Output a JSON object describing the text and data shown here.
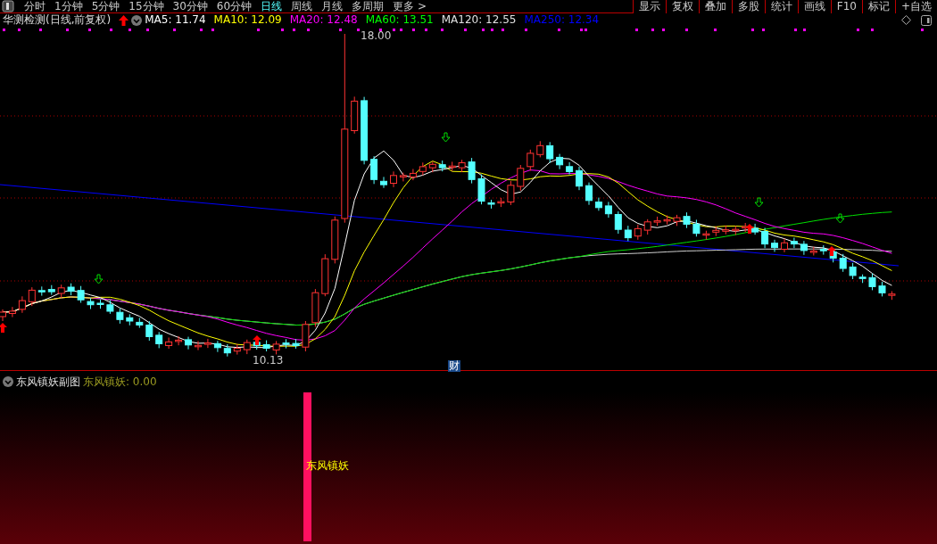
{
  "toolbar": {
    "periods": [
      {
        "label": "分时",
        "selected": false
      },
      {
        "label": "1分钟",
        "selected": false
      },
      {
        "label": "5分钟",
        "selected": false
      },
      {
        "label": "15分钟",
        "selected": false
      },
      {
        "label": "30分钟",
        "selected": false
      },
      {
        "label": "60分钟",
        "selected": false
      },
      {
        "label": "日线",
        "selected": true
      },
      {
        "label": "周线",
        "selected": false
      },
      {
        "label": "月线",
        "selected": false
      },
      {
        "label": "多周期",
        "selected": false
      },
      {
        "label": "更多 >",
        "selected": false
      }
    ],
    "buttons": [
      "显示",
      "复权",
      "叠加",
      "多股",
      "统计",
      "画线",
      "F10",
      "标记",
      "+自选"
    ]
  },
  "legend": {
    "title": "华测检测(日线,前复权)",
    "averages": [
      {
        "label": "MA5: 11.74",
        "color": "#ffffff"
      },
      {
        "label": "MA10: 12.09",
        "color": "#ffff00"
      },
      {
        "label": "MA20: 12.48",
        "color": "#ff00ff"
      },
      {
        "label": "MA60: 13.51",
        "color": "#00ff00"
      },
      {
        "label": "MA120: 12.55",
        "color": "#e0e0e0"
      },
      {
        "label": "MA250: 12.34",
        "color": "#0000ff"
      }
    ]
  },
  "main_chart": {
    "high_label": "18.00",
    "low_label": "10.13",
    "finance_marker": "财"
  },
  "sub_chart": {
    "title": "东风镇妖副图",
    "value": "东风镇妖: 0.00",
    "signal_label": "东风镇妖"
  }
}
